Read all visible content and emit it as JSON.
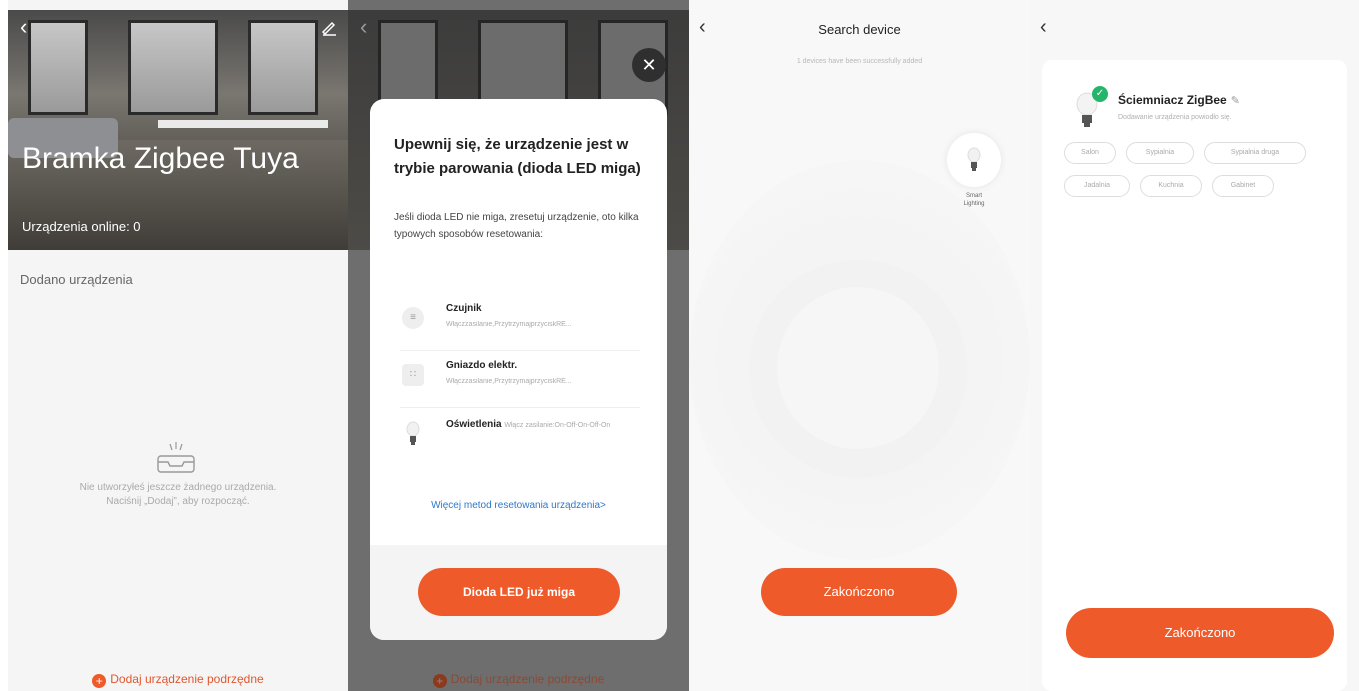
{
  "panel1": {
    "title": "Bramka Zigbee Tuya",
    "online": "Urządzenia online: 0",
    "section": "Dodano urządzenia",
    "empty_line1": "Nie utworzyłeś jeszcze żadnego urządzenia.",
    "empty_line2": "Naciśnij „Dodaj”, aby rozpocząć.",
    "add_label": "Dodaj urządzenie podrzędne"
  },
  "panel2": {
    "title": "Upewnij się, że urządzenie jest w trybie parowania (dioda LED miga)",
    "desc": "Jeśli dioda LED nie miga, zresetuj urządzenie, oto kilka typowych sposobów resetowania:",
    "methods": [
      {
        "name": "Czujnik",
        "sub": "Włączzasilanie,PrzytrzymajprzyciskRE..."
      },
      {
        "name": "Gniazdo elektr.",
        "sub": "Włączzasilanie,PrzytrzymajprzyciskRE..."
      },
      {
        "name": "Oświetlenia",
        "sub": "Włącz zasilanie:On-Off-On-Off-On"
      }
    ],
    "more_link": "Więcej metod resetowania urządzenia>",
    "led_button": "Dioda LED już miga",
    "add_label": "Dodaj urządzenie podrzędne"
  },
  "panel3": {
    "title": "Search device",
    "subtitle": "1 devices have been successfully added",
    "device_label_line1": "Smart",
    "device_label_line2": "Lighting",
    "done_button": "Zakończono"
  },
  "panel4": {
    "device_name": "Ściemniacz ZigBee",
    "status": "Dodawanie urządzenia powiodło się.",
    "rooms": [
      "Salon",
      "Sypialnia",
      "Sypialnia druga",
      "Jadalnia",
      "Kuchnia",
      "Gabinet"
    ],
    "done_button": "Zakończono"
  },
  "colors": {
    "accent": "#ef5a2a",
    "success": "#25b56a",
    "link": "#2f78c9"
  }
}
